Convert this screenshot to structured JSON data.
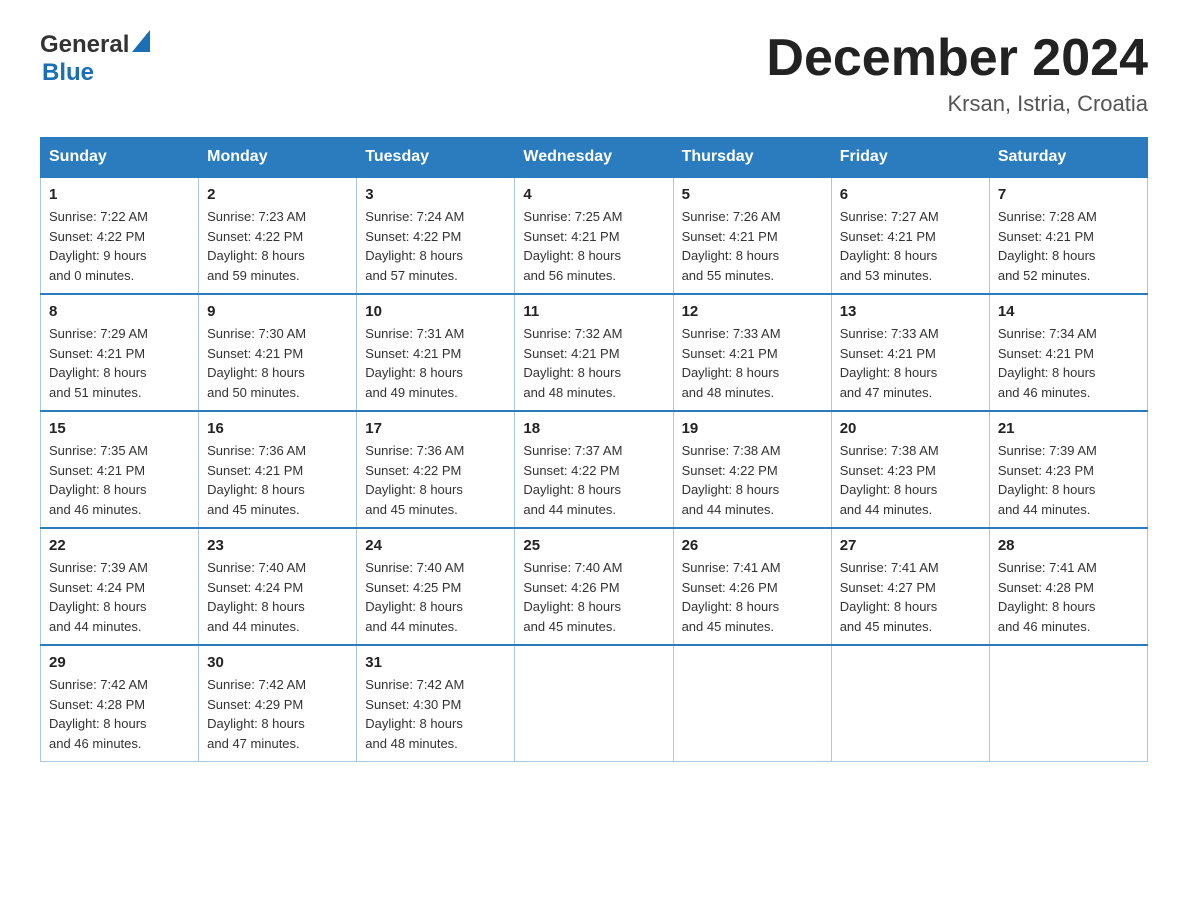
{
  "logo": {
    "general": "General",
    "blue": "Blue"
  },
  "title": {
    "month_year": "December 2024",
    "location": "Krsan, Istria, Croatia"
  },
  "headers": [
    "Sunday",
    "Monday",
    "Tuesday",
    "Wednesday",
    "Thursday",
    "Friday",
    "Saturday"
  ],
  "weeks": [
    [
      {
        "day": "1",
        "sunrise": "7:22 AM",
        "sunset": "4:22 PM",
        "daylight": "9 hours and 0 minutes."
      },
      {
        "day": "2",
        "sunrise": "7:23 AM",
        "sunset": "4:22 PM",
        "daylight": "8 hours and 59 minutes."
      },
      {
        "day": "3",
        "sunrise": "7:24 AM",
        "sunset": "4:22 PM",
        "daylight": "8 hours and 57 minutes."
      },
      {
        "day": "4",
        "sunrise": "7:25 AM",
        "sunset": "4:21 PM",
        "daylight": "8 hours and 56 minutes."
      },
      {
        "day": "5",
        "sunrise": "7:26 AM",
        "sunset": "4:21 PM",
        "daylight": "8 hours and 55 minutes."
      },
      {
        "day": "6",
        "sunrise": "7:27 AM",
        "sunset": "4:21 PM",
        "daylight": "8 hours and 53 minutes."
      },
      {
        "day": "7",
        "sunrise": "7:28 AM",
        "sunset": "4:21 PM",
        "daylight": "8 hours and 52 minutes."
      }
    ],
    [
      {
        "day": "8",
        "sunrise": "7:29 AM",
        "sunset": "4:21 PM",
        "daylight": "8 hours and 51 minutes."
      },
      {
        "day": "9",
        "sunrise": "7:30 AM",
        "sunset": "4:21 PM",
        "daylight": "8 hours and 50 minutes."
      },
      {
        "day": "10",
        "sunrise": "7:31 AM",
        "sunset": "4:21 PM",
        "daylight": "8 hours and 49 minutes."
      },
      {
        "day": "11",
        "sunrise": "7:32 AM",
        "sunset": "4:21 PM",
        "daylight": "8 hours and 48 minutes."
      },
      {
        "day": "12",
        "sunrise": "7:33 AM",
        "sunset": "4:21 PM",
        "daylight": "8 hours and 48 minutes."
      },
      {
        "day": "13",
        "sunrise": "7:33 AM",
        "sunset": "4:21 PM",
        "daylight": "8 hours and 47 minutes."
      },
      {
        "day": "14",
        "sunrise": "7:34 AM",
        "sunset": "4:21 PM",
        "daylight": "8 hours and 46 minutes."
      }
    ],
    [
      {
        "day": "15",
        "sunrise": "7:35 AM",
        "sunset": "4:21 PM",
        "daylight": "8 hours and 46 minutes."
      },
      {
        "day": "16",
        "sunrise": "7:36 AM",
        "sunset": "4:21 PM",
        "daylight": "8 hours and 45 minutes."
      },
      {
        "day": "17",
        "sunrise": "7:36 AM",
        "sunset": "4:22 PM",
        "daylight": "8 hours and 45 minutes."
      },
      {
        "day": "18",
        "sunrise": "7:37 AM",
        "sunset": "4:22 PM",
        "daylight": "8 hours and 44 minutes."
      },
      {
        "day": "19",
        "sunrise": "7:38 AM",
        "sunset": "4:22 PM",
        "daylight": "8 hours and 44 minutes."
      },
      {
        "day": "20",
        "sunrise": "7:38 AM",
        "sunset": "4:23 PM",
        "daylight": "8 hours and 44 minutes."
      },
      {
        "day": "21",
        "sunrise": "7:39 AM",
        "sunset": "4:23 PM",
        "daylight": "8 hours and 44 minutes."
      }
    ],
    [
      {
        "day": "22",
        "sunrise": "7:39 AM",
        "sunset": "4:24 PM",
        "daylight": "8 hours and 44 minutes."
      },
      {
        "day": "23",
        "sunrise": "7:40 AM",
        "sunset": "4:24 PM",
        "daylight": "8 hours and 44 minutes."
      },
      {
        "day": "24",
        "sunrise": "7:40 AM",
        "sunset": "4:25 PM",
        "daylight": "8 hours and 44 minutes."
      },
      {
        "day": "25",
        "sunrise": "7:40 AM",
        "sunset": "4:26 PM",
        "daylight": "8 hours and 45 minutes."
      },
      {
        "day": "26",
        "sunrise": "7:41 AM",
        "sunset": "4:26 PM",
        "daylight": "8 hours and 45 minutes."
      },
      {
        "day": "27",
        "sunrise": "7:41 AM",
        "sunset": "4:27 PM",
        "daylight": "8 hours and 45 minutes."
      },
      {
        "day": "28",
        "sunrise": "7:41 AM",
        "sunset": "4:28 PM",
        "daylight": "8 hours and 46 minutes."
      }
    ],
    [
      {
        "day": "29",
        "sunrise": "7:42 AM",
        "sunset": "4:28 PM",
        "daylight": "8 hours and 46 minutes."
      },
      {
        "day": "30",
        "sunrise": "7:42 AM",
        "sunset": "4:29 PM",
        "daylight": "8 hours and 47 minutes."
      },
      {
        "day": "31",
        "sunrise": "7:42 AM",
        "sunset": "4:30 PM",
        "daylight": "8 hours and 48 minutes."
      },
      null,
      null,
      null,
      null
    ]
  ],
  "labels": {
    "sunrise": "Sunrise:",
    "sunset": "Sunset:",
    "daylight": "Daylight:"
  }
}
